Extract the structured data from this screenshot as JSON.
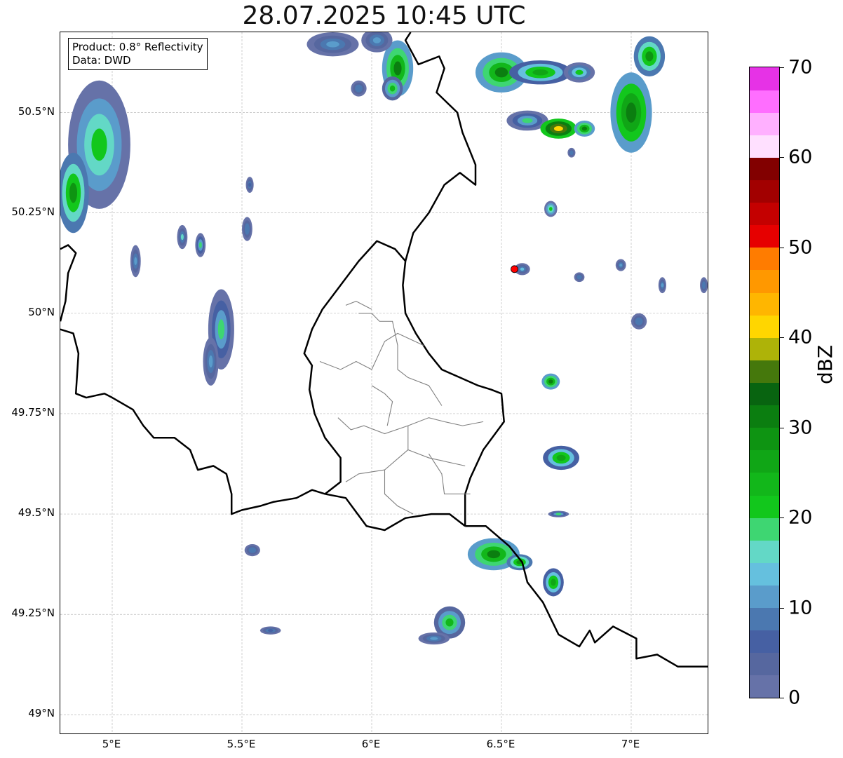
{
  "title": "28.07.2025 10:45 UTC",
  "info_box": {
    "product": "Product: 0.8° Reflectivity",
    "data": "Data: DWD"
  },
  "map": {
    "lon_range": [
      4.8,
      7.3
    ],
    "lat_range": [
      48.95,
      50.7
    ],
    "x_ticks": [
      {
        "value": 5.0,
        "label": "5°E"
      },
      {
        "value": 5.5,
        "label": "5.5°E"
      },
      {
        "value": 6.0,
        "label": "6°E"
      },
      {
        "value": 6.5,
        "label": "6.5°E"
      },
      {
        "value": 7.0,
        "label": "7°E"
      }
    ],
    "y_ticks": [
      {
        "value": 50.5,
        "label": "50.5°N"
      },
      {
        "value": 50.25,
        "label": "50.25°N"
      },
      {
        "value": 50.0,
        "label": "50°N"
      },
      {
        "value": 49.75,
        "label": "49.75°N"
      },
      {
        "value": 49.5,
        "label": "49.5°N"
      },
      {
        "value": 49.25,
        "label": "49.25°N"
      },
      {
        "value": 49.0,
        "label": "49°N"
      }
    ],
    "grid": true,
    "radar_site": {
      "lon": 6.55,
      "lat": 50.11
    },
    "echoes": [
      {
        "lon": 4.95,
        "lat": 50.42,
        "rlon": 0.12,
        "rlat": 0.16,
        "dbz": 22
      },
      {
        "lon": 4.85,
        "lat": 50.3,
        "rlon": 0.06,
        "rlat": 0.1,
        "dbz": 28
      },
      {
        "lon": 5.42,
        "lat": 49.96,
        "rlon": 0.05,
        "rlat": 0.1,
        "dbz": 18
      },
      {
        "lon": 5.38,
        "lat": 49.88,
        "rlon": 0.03,
        "rlat": 0.06,
        "dbz": 12
      },
      {
        "lon": 5.09,
        "lat": 50.13,
        "rlon": 0.02,
        "rlat": 0.04,
        "dbz": 10
      },
      {
        "lon": 5.27,
        "lat": 50.19,
        "rlon": 0.02,
        "rlat": 0.03,
        "dbz": 15
      },
      {
        "lon": 5.34,
        "lat": 50.17,
        "rlon": 0.02,
        "rlat": 0.03,
        "dbz": 18
      },
      {
        "lon": 5.52,
        "lat": 50.21,
        "rlon": 0.02,
        "rlat": 0.03,
        "dbz": 8
      },
      {
        "lon": 5.53,
        "lat": 50.32,
        "rlon": 0.015,
        "rlat": 0.02,
        "dbz": 6
      },
      {
        "lon": 5.85,
        "lat": 50.67,
        "rlon": 0.1,
        "rlat": 0.03,
        "dbz": 12
      },
      {
        "lon": 6.1,
        "lat": 50.61,
        "rlon": 0.06,
        "rlat": 0.07,
        "dbz": 30
      },
      {
        "lon": 6.08,
        "lat": 50.56,
        "rlon": 0.04,
        "rlat": 0.03,
        "dbz": 24
      },
      {
        "lon": 6.02,
        "lat": 50.68,
        "rlon": 0.06,
        "rlat": 0.03,
        "dbz": 10
      },
      {
        "lon": 6.5,
        "lat": 50.6,
        "rlon": 0.1,
        "rlat": 0.05,
        "dbz": 30
      },
      {
        "lon": 6.65,
        "lat": 50.6,
        "rlon": 0.12,
        "rlat": 0.03,
        "dbz": 26
      },
      {
        "lon": 6.8,
        "lat": 50.6,
        "rlon": 0.06,
        "rlat": 0.025,
        "dbz": 20
      },
      {
        "lon": 6.6,
        "lat": 50.48,
        "rlon": 0.08,
        "rlat": 0.025,
        "dbz": 18
      },
      {
        "lon": 6.72,
        "lat": 50.46,
        "rlon": 0.07,
        "rlat": 0.025,
        "dbz": 42
      },
      {
        "lon": 6.82,
        "lat": 50.46,
        "rlon": 0.04,
        "rlat": 0.02,
        "dbz": 30
      },
      {
        "lon": 7.0,
        "lat": 50.5,
        "rlon": 0.08,
        "rlat": 0.1,
        "dbz": 32
      },
      {
        "lon": 7.07,
        "lat": 50.64,
        "rlon": 0.06,
        "rlat": 0.05,
        "dbz": 28
      },
      {
        "lon": 6.69,
        "lat": 50.26,
        "rlon": 0.025,
        "rlat": 0.02,
        "dbz": 22
      },
      {
        "lon": 6.58,
        "lat": 50.11,
        "rlon": 0.03,
        "rlat": 0.015,
        "dbz": 14
      },
      {
        "lon": 6.69,
        "lat": 49.83,
        "rlon": 0.035,
        "rlat": 0.02,
        "dbz": 30
      },
      {
        "lon": 6.73,
        "lat": 49.64,
        "rlon": 0.07,
        "rlat": 0.03,
        "dbz": 26
      },
      {
        "lon": 6.72,
        "lat": 49.5,
        "rlon": 0.04,
        "rlat": 0.008,
        "dbz": 18
      },
      {
        "lon": 6.47,
        "lat": 49.4,
        "rlon": 0.1,
        "rlat": 0.04,
        "dbz": 30
      },
      {
        "lon": 6.57,
        "lat": 49.38,
        "rlon": 0.05,
        "rlat": 0.02,
        "dbz": 28
      },
      {
        "lon": 6.7,
        "lat": 49.33,
        "rlon": 0.04,
        "rlat": 0.035,
        "dbz": 26
      },
      {
        "lon": 6.3,
        "lat": 49.23,
        "rlon": 0.06,
        "rlat": 0.04,
        "dbz": 24
      },
      {
        "lon": 6.24,
        "lat": 49.19,
        "rlon": 0.06,
        "rlat": 0.015,
        "dbz": 10
      },
      {
        "lon": 7.03,
        "lat": 49.98,
        "rlon": 0.03,
        "rlat": 0.02,
        "dbz": 8
      },
      {
        "lon": 6.96,
        "lat": 50.12,
        "rlon": 0.02,
        "rlat": 0.015,
        "dbz": 10
      },
      {
        "lon": 6.8,
        "lat": 50.09,
        "rlon": 0.02,
        "rlat": 0.012,
        "dbz": 8
      },
      {
        "lon": 7.12,
        "lat": 50.07,
        "rlon": 0.015,
        "rlat": 0.02,
        "dbz": 12
      },
      {
        "lon": 7.28,
        "lat": 50.07,
        "rlon": 0.015,
        "rlat": 0.02,
        "dbz": 8
      },
      {
        "lon": 5.61,
        "lat": 49.21,
        "rlon": 0.04,
        "rlat": 0.01,
        "dbz": 6
      },
      {
        "lon": 5.54,
        "lat": 49.41,
        "rlon": 0.03,
        "rlat": 0.015,
        "dbz": 8
      },
      {
        "lon": 6.77,
        "lat": 50.4,
        "rlon": 0.015,
        "rlat": 0.012,
        "dbz": 8
      },
      {
        "lon": 5.95,
        "lat": 50.56,
        "rlon": 0.03,
        "rlat": 0.02,
        "dbz": 8
      }
    ]
  },
  "colorbar": {
    "label": "dBZ",
    "min": 0,
    "max": 70,
    "step": 2.5,
    "tick_labels": [
      "0",
      "10",
      "20",
      "30",
      "40",
      "50",
      "60",
      "70"
    ],
    "colors": [
      "#6672a8",
      "#56679f",
      "#4660a3",
      "#4b78b0",
      "#5a9ccb",
      "#65c0de",
      "#63d8c6",
      "#3ed672",
      "#12c71c",
      "#12b71a",
      "#10a616",
      "#0e9412",
      "#0b7e10",
      "#086410",
      "#45780c",
      "#aeb308",
      "#ffd600",
      "#ffb600",
      "#ff9800",
      "#ff7c00",
      "#e60000",
      "#c40000",
      "#a20000",
      "#820000",
      "#ffe0ff",
      "#ffb0ff",
      "#ff6eff",
      "#e632e6"
    ]
  },
  "colors": {
    "border_country": "#000000",
    "border_canton": "#808080",
    "grid": "#bbbbbb",
    "radar_site": "#ff0000"
  }
}
